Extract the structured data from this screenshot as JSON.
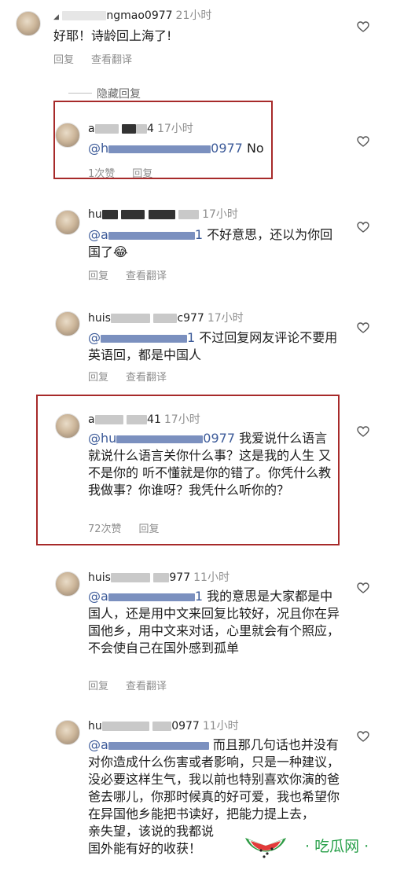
{
  "comments": [
    {
      "user_suffix": "ngmao0977",
      "time": "21小时",
      "text": "好耶！诗龄回上海了!",
      "reply": "回复",
      "translate": "查看翻译"
    },
    {
      "user_prefix": "a",
      "user_suffix": "4",
      "time": "17小时",
      "mention_suffix": "0977",
      "text": " No",
      "likes": "1次赞",
      "reply": "回复"
    },
    {
      "user_prefix": "hu",
      "time": "17小时",
      "mention_prefix": "@a",
      "mention_suffix": "1",
      "text": " 不好意思，还以为你回国了😂",
      "reply": "回复",
      "translate": "查看翻译"
    },
    {
      "user_prefix": "huis",
      "user_suffix": "c977",
      "time": "17小时",
      "mention_prefix": "@",
      "mention_suffix": "1",
      "text": " 不过回复网友评论不要用英语回，都是中国人",
      "reply": "回复",
      "translate": "查看翻译"
    },
    {
      "user_prefix": "a",
      "user_suffix": "41",
      "time": "17小时",
      "mention_prefix": "@hu",
      "mention_suffix": "0977",
      "text": " 我爱说什么语言就说什么语言关你什么事？这是我的人生 又不是你的 听不懂就是你的错了。你凭什么教我做事？你谁呀？我凭什么听你的？",
      "likes": "72次赞",
      "reply": "回复"
    },
    {
      "user_prefix": "huis",
      "user_suffix": "977",
      "time": "11小时",
      "mention_prefix": "@a",
      "mention_suffix": "1",
      "text": " 我的意思是大家都是中国人，还是用中文来回复比较好，况且你在异国他乡，用中文来对话，心里就会有个照应，不会使自己在国外感到孤单",
      "reply": "回复",
      "translate": "查看翻译"
    },
    {
      "user_prefix": "hu",
      "user_suffix": "0977",
      "time": "11小时",
      "mention_prefix": "@a",
      "text": " 而且那几句话也并没有对你造成什么伤害或者影响，只是一种建议，没必要这样生气，我以前也特别喜欢你演的爸爸去哪儿，你那时候真的好可爱，我也希望你在异国他乡能把书读好，把能力提上去，",
      "text2": "亲失望，该说的我都说",
      "text3": "国外能有好的收获！"
    }
  ],
  "hidden_replies": "隐藏回复",
  "watermark": {
    "text": "吃瓜网",
    "accent": "#29a04a"
  },
  "colors": {
    "highlight_border": "#a72a2a",
    "mention": "#3d5b99",
    "meta": "#8e8e8e"
  }
}
